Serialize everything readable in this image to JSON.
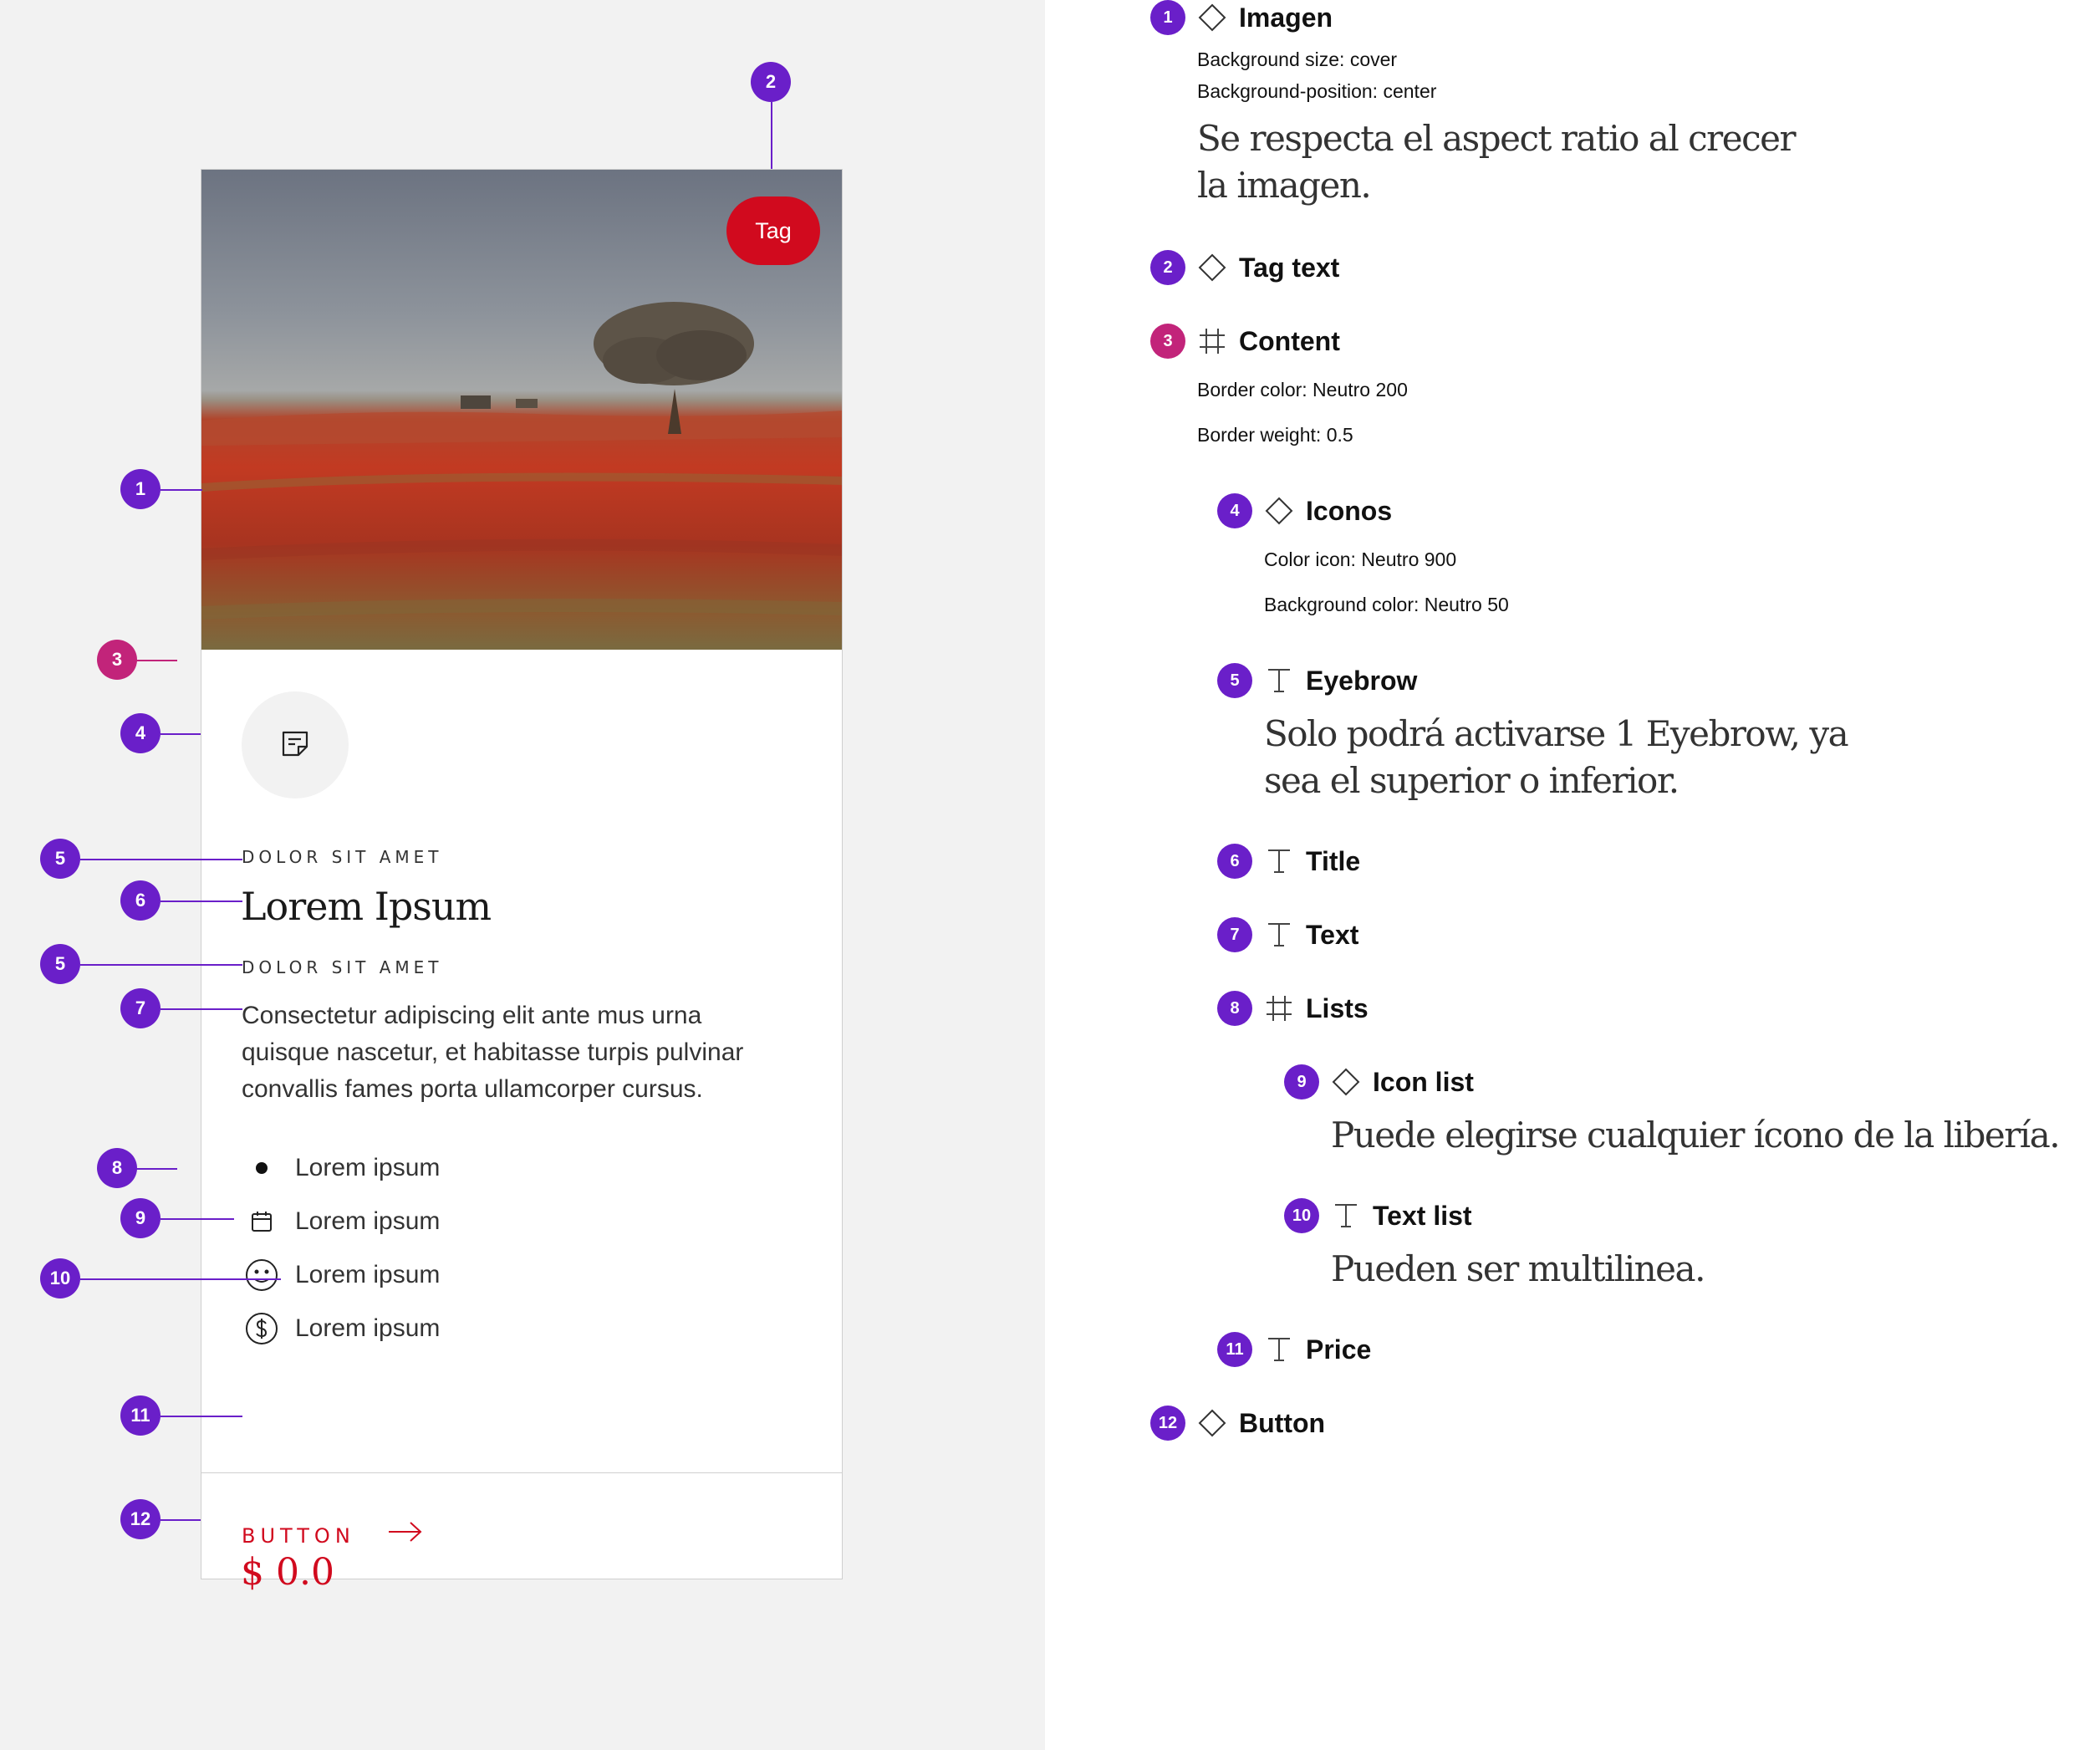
{
  "card": {
    "tag": "Tag",
    "eyebrow_top": "DOLOR SIT AMET",
    "title": "Lorem Ipsum",
    "eyebrow_bottom": "DOLOR SIT AMET",
    "text": "Consectetur adipiscing elit ante mus urna quisque nascetur, et habitasse turpis pulvinar convallis fames porta ullamcorper cursus.",
    "list": [
      {
        "icon": "bullet-icon",
        "label": "Lorem ipsum"
      },
      {
        "icon": "calendar-icon",
        "label": "Lorem ipsum"
      },
      {
        "icon": "smiley-icon",
        "label": "Lorem ipsum"
      },
      {
        "icon": "dollar-icon",
        "label": "Lorem ipsum"
      }
    ],
    "price": "$ 0.0",
    "button_label": "BUTTON",
    "accent_color": "#d10a1e"
  },
  "markers": [
    "1",
    "2",
    "3",
    "4",
    "5",
    "6",
    "5",
    "7",
    "8",
    "9",
    "10",
    "11",
    "12"
  ],
  "spec": {
    "imagen": {
      "number": "1",
      "name": "Imagen",
      "prop1": "Background size: cover",
      "prop2": "Background-position: center",
      "note": "Se respecta el aspect ratio al crecer la imagen."
    },
    "tag_text": {
      "number": "2",
      "name": "Tag text"
    },
    "content": {
      "number": "3",
      "name": "Content",
      "prop1": "Border color:  Neutro 200",
      "prop2": "Border weight: 0.5"
    },
    "iconos": {
      "number": "4",
      "name": "Iconos",
      "prop1": "Color icon: Neutro 900",
      "prop2": "Background color: Neutro 50"
    },
    "eyebrow": {
      "number": "5",
      "name": "Eyebrow",
      "note": "Solo podrá activarse 1 Eyebrow, ya sea el superior o inferior."
    },
    "title": {
      "number": "6",
      "name": "Title"
    },
    "text": {
      "number": "7",
      "name": "Text"
    },
    "lists": {
      "number": "8",
      "name": "Lists"
    },
    "icon_list": {
      "number": "9",
      "name": "Icon list",
      "note": "Puede elegirse cualquier ícono de la libería."
    },
    "text_list": {
      "number": "10",
      "name": "Text list",
      "note": "Pueden ser multilinea."
    },
    "price": {
      "number": "11",
      "name": "Price"
    },
    "button": {
      "number": "12",
      "name": "Button"
    }
  },
  "colors": {
    "marker": "#6a1fc9",
    "marker_alt": "#c2247a",
    "panel_bg": "#f2f2f2"
  }
}
